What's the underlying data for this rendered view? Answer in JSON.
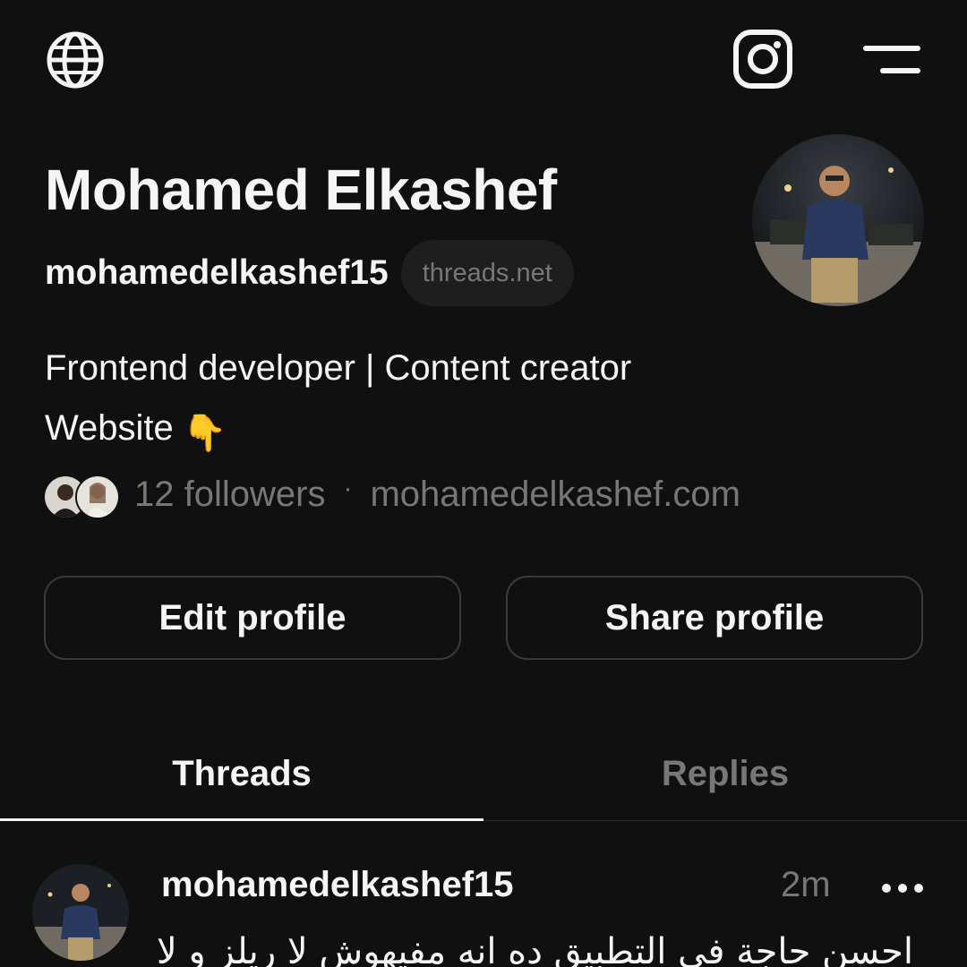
{
  "topbar": {
    "left_icon": "globe-icon",
    "instagram_icon": "instagram-icon",
    "menu_icon": "menu-icon"
  },
  "profile": {
    "name": "Mohamed Elkashef",
    "handle": "mohamedelkashef15",
    "domain_badge": "threads.net",
    "bio_line1": "Frontend developer | Content creator",
    "bio_line2": "Website",
    "bio_emoji": "👇",
    "followers": "12 followers",
    "separator": "·",
    "website": "mohamedelkashef.com"
  },
  "actions": {
    "edit_label": "Edit profile",
    "share_label": "Share profile"
  },
  "tabs": [
    {
      "label": "Threads",
      "active": true
    },
    {
      "label": "Replies",
      "active": false
    }
  ],
  "post": {
    "username": "mohamedelkashef15",
    "time": "2m",
    "text": "احسن حاجة في التطبيق ده انه مفيهوش لا ريلز و لا"
  },
  "colors": {
    "background": "#101010",
    "text": "#f3f5f7",
    "muted": "#777777",
    "border": "#3a3a3a"
  }
}
